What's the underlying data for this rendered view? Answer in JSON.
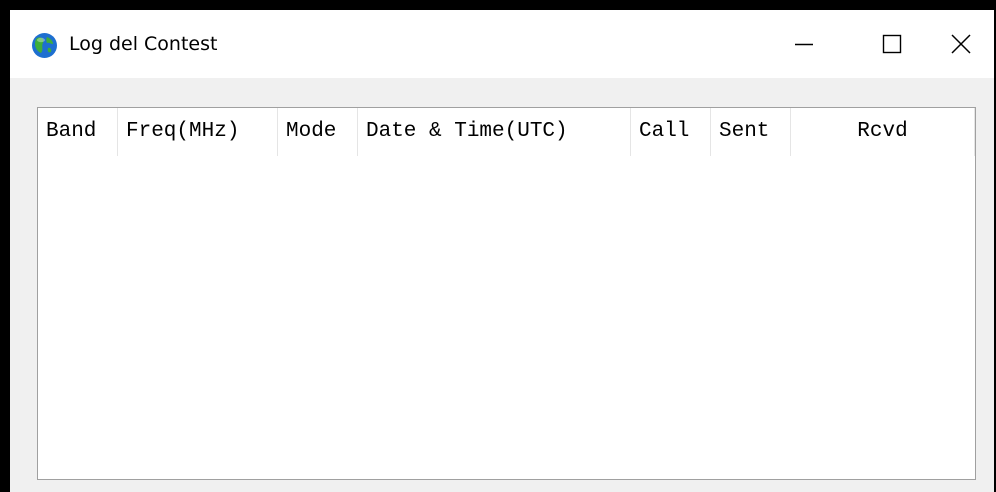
{
  "window": {
    "title": "Log del Contest",
    "icon": "globe-icon",
    "controls": {
      "minimize": "minimize-icon",
      "maximize": "maximize-icon",
      "close": "close-icon"
    }
  },
  "log_table": {
    "columns": [
      {
        "label": "Band"
      },
      {
        "label": "Freq(MHz)"
      },
      {
        "label": "Mode"
      },
      {
        "label": "Date & Time(UTC)"
      },
      {
        "label": "Call"
      },
      {
        "label": "Sent"
      },
      {
        "label": "Rcvd"
      }
    ],
    "rows": []
  },
  "colors": {
    "titlebar": "#ffffff",
    "client_background": "#f0f0f0",
    "list_border": "#a0a0a0",
    "outer_frame": "#000000"
  }
}
